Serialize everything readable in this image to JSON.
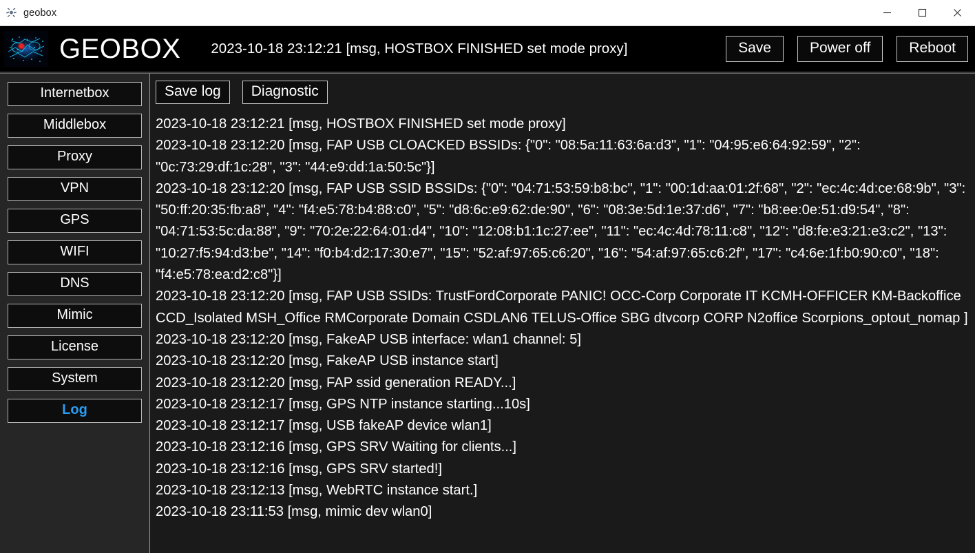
{
  "window": {
    "title": "geobox",
    "icon": "geobox-app-icon",
    "controls": {
      "minimize": "minimize-icon",
      "maximize": "maximize-icon",
      "close": "close-icon"
    }
  },
  "header": {
    "logo_alt": "geobox-logo",
    "brand": "GEOBOX",
    "status": "2023-10-18 23:12:21 [msg, HOSTBOX FINISHED set mode proxy]",
    "buttons": [
      {
        "label": "Save",
        "name": "save-button"
      },
      {
        "label": "Power off",
        "name": "power-off-button"
      },
      {
        "label": "Reboot",
        "name": "reboot-button"
      }
    ]
  },
  "sidebar": {
    "items": [
      {
        "label": "Internetbox",
        "active": false
      },
      {
        "label": "Middlebox",
        "active": false
      },
      {
        "label": "Proxy",
        "active": false
      },
      {
        "label": "VPN",
        "active": false
      },
      {
        "label": "GPS",
        "active": false
      },
      {
        "label": "WIFI",
        "active": false
      },
      {
        "label": "DNS",
        "active": false
      },
      {
        "label": "Mimic",
        "active": false
      },
      {
        "label": "License",
        "active": false
      },
      {
        "label": "System",
        "active": false
      },
      {
        "label": "Log",
        "active": true
      }
    ],
    "active_color": "#2a9df4"
  },
  "content": {
    "toolbar": [
      {
        "label": "Save log",
        "name": "save-log-button"
      },
      {
        "label": "Diagnostic",
        "name": "diagnostic-button"
      }
    ],
    "log_lines": [
      "2023-10-18 23:12:21 [msg, HOSTBOX FINISHED set mode proxy]",
      "2023-10-18 23:12:20 [msg, FAP USB CLOACKED BSSIDs: {\"0\": \"08:5a:11:63:6a:d3\", \"1\": \"04:95:e6:64:92:59\", \"2\": \"0c:73:29:df:1c:28\", \"3\": \"44:e9:dd:1a:50:5c\"}]",
      "2023-10-18 23:12:20 [msg, FAP USB SSID BSSIDs: {\"0\": \"04:71:53:59:b8:bc\", \"1\": \"00:1d:aa:01:2f:68\", \"2\": \"ec:4c:4d:ce:68:9b\", \"3\": \"50:ff:20:35:fb:a8\", \"4\": \"f4:e5:78:b4:88:c0\", \"5\": \"d8:6c:e9:62:de:90\", \"6\": \"08:3e:5d:1e:37:d6\", \"7\": \"b8:ee:0e:51:d9:54\", \"8\": \"04:71:53:5c:da:88\", \"9\": \"70:2e:22:64:01:d4\", \"10\": \"12:08:b1:1c:27:ee\", \"11\": \"ec:4c:4d:78:11:c8\", \"12\": \"d8:fe:e3:21:e3:c2\", \"13\": \"10:27:f5:94:d3:be\", \"14\": \"f0:b4:d2:17:30:e7\", \"15\": \"52:af:97:65:c6:20\", \"16\": \"54:af:97:65:c6:2f\", \"17\": \"c4:6e:1f:b0:90:c0\", \"18\": \"f4:e5:78:ea:d2:c8\"}]",
      "2023-10-18 23:12:20 [msg, FAP USB SSIDs: TrustFordCorporate PANIC! OCC-Corp Corporate IT KCMH-OFFICER KM-Backoffice CCD_Isolated MSH_Office RMCorporate Domain CSDLAN6 TELUS-Office SBG dtvcorp CORP N2office Scorpions_optout_nomap ]",
      "2023-10-18 23:12:20 [msg, FakeAP USB interface: wlan1 channel: 5]",
      "2023-10-18 23:12:20 [msg, FakeAP USB instance start]",
      "2023-10-18 23:12:20 [msg, FAP ssid generation READY...]",
      "2023-10-18 23:12:17 [msg, GPS NTP instance starting...10s]",
      "2023-10-18 23:12:17 [msg, USB fakeAP device wlan1]",
      "2023-10-18 23:12:16 [msg, GPS SRV Waiting for clients...]",
      "2023-10-18 23:12:16 [msg, GPS SRV started!]",
      "2023-10-18 23:12:13 [msg, WebRTC instance start.]",
      "2023-10-18 23:11:53 [msg, mimic dev wlan0]"
    ]
  },
  "colors": {
    "titlebar_bg": "#ffffff",
    "header_bg": "#000000",
    "sidebar_bg": "#262626",
    "content_bg": "#1a1a1a",
    "text": "#ffffff",
    "accent": "#2a9df4",
    "button_border": "#c8c8c8"
  }
}
